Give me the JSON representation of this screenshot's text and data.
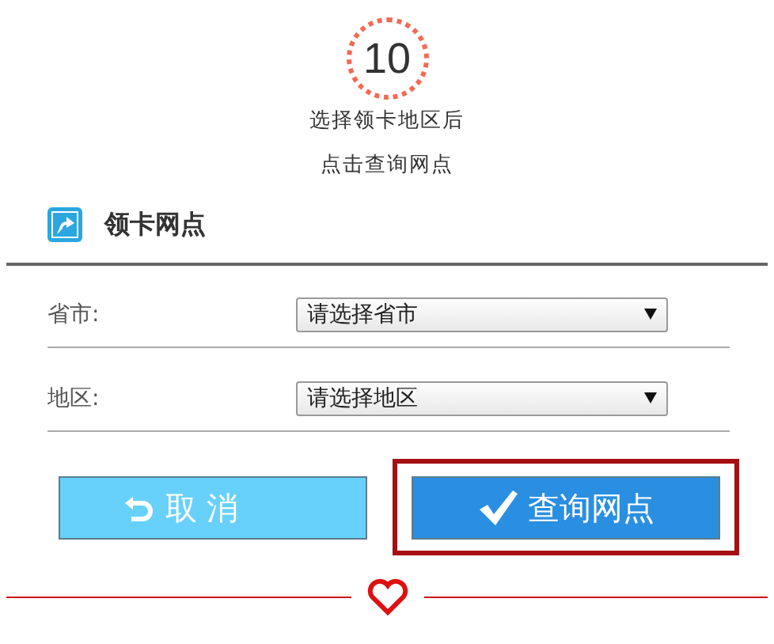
{
  "step": {
    "number": "10",
    "caption": [
      "选择领卡地区后",
      "点击查询网点"
    ]
  },
  "section": {
    "title": "领卡网点"
  },
  "fields": [
    {
      "label": "省市:",
      "value": "请选择省市"
    },
    {
      "label": "地区:",
      "value": "请选择地区"
    }
  ],
  "buttons": [
    {
      "kind": "cancel",
      "label": "取 消",
      "highlighted": false
    },
    {
      "kind": "confirm",
      "label": "查询网点",
      "highlighted": true
    }
  ]
}
